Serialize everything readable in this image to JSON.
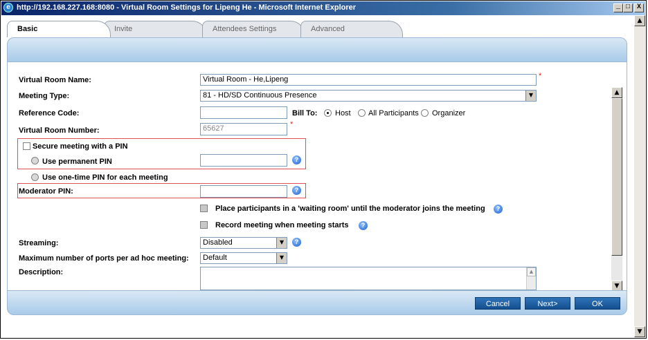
{
  "window": {
    "title": "http://192.168.227.168:8080 - Virtual Room Settings for Lipeng He - Microsoft Internet Explorer",
    "minimize": "_",
    "maximize": "□",
    "close": "X"
  },
  "tabs": [
    {
      "label": "Basic"
    },
    {
      "label": "Invite"
    },
    {
      "label": "Attendees Settings"
    },
    {
      "label": "Advanced"
    }
  ],
  "form": {
    "virtual_room_name": {
      "label": "Virtual Room Name:",
      "value": "Virtual Room - He,Lipeng"
    },
    "meeting_type": {
      "label": "Meeting Type:",
      "value": "81 - HD/SD Continuous Presence"
    },
    "reference_code": {
      "label": "Reference Code:",
      "value": ""
    },
    "bill_to": {
      "label": "Bill To:",
      "options": [
        "Host",
        "All Participants",
        "Organizer"
      ],
      "selected": "Host"
    },
    "virtual_room_number": {
      "label": "Virtual Room Number:",
      "value": "65627"
    },
    "secure_pin": {
      "label": "Secure meeting with a PIN"
    },
    "permanent_pin": {
      "label": "Use permanent PIN",
      "value": ""
    },
    "one_time_pin": {
      "label": "Use one-time PIN for each meeting"
    },
    "moderator_pin": {
      "label": "Moderator PIN:",
      "value": ""
    },
    "waiting_room": {
      "label": "Place participants in a 'waiting room' until the moderator joins the meeting"
    },
    "record_meeting": {
      "label": "Record meeting when meeting starts"
    },
    "streaming": {
      "label": "Streaming:",
      "value": "Disabled"
    },
    "max_ports": {
      "label": "Maximum number of ports per ad hoc meeting:",
      "value": "Default"
    },
    "description": {
      "label": "Description:",
      "value": ""
    },
    "required_mark": "*",
    "help_glyph": "?"
  },
  "footer": {
    "cancel": "Cancel",
    "next": "Next>",
    "ok": "OK"
  },
  "icons": {
    "arrow_up": "▲",
    "arrow_down": "▼"
  }
}
